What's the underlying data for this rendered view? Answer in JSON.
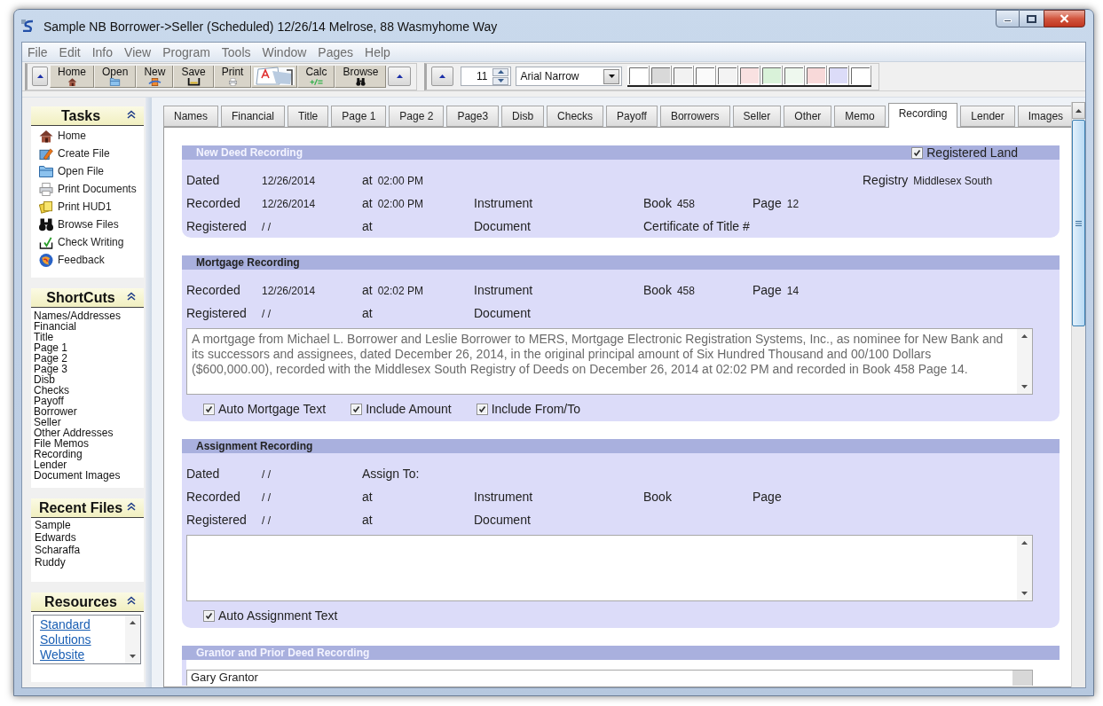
{
  "window": {
    "title": "Sample NB Borrower->Seller (Scheduled) 12/26/14 Melrose, 88 Wasmyhome Way"
  },
  "menu": [
    "File",
    "Edit",
    "Info",
    "View",
    "Program",
    "Tools",
    "Window",
    "Pages",
    "Help"
  ],
  "toolbar": {
    "buttons": [
      {
        "kind": "labeled",
        "label": "Home"
      },
      {
        "kind": "labeled",
        "label": "Open"
      },
      {
        "kind": "labeled",
        "label": "New"
      },
      {
        "kind": "labeled",
        "label": "Save"
      },
      {
        "kind": "labeled",
        "label": "Print"
      },
      {
        "kind": "picture"
      },
      {
        "kind": "labeled",
        "label": "Calc"
      },
      {
        "kind": "labeled",
        "label": "Browse"
      }
    ]
  },
  "format_bar": {
    "font_size": "11",
    "font": "Arial Narrow",
    "swatches": [
      {
        "color": "#ffffff"
      },
      {
        "color": "#d9d9d9"
      },
      {
        "color": "#f2f2f2"
      },
      {
        "color": "#fafafa"
      },
      {
        "color": "#f3f3f3"
      },
      {
        "color": "#f9e1e1"
      },
      {
        "color": "#d9f2d9"
      },
      {
        "color": "#eef8ee"
      },
      {
        "color": "#f8d9d9"
      },
      {
        "color": "#dcdcf8"
      },
      {
        "color": "#ffffff"
      }
    ]
  },
  "sidebar": {
    "panels": [
      {
        "title": "Tasks",
        "kind": "tasks",
        "items": [
          "Home",
          "Create File",
          "Open File",
          "Print Documents",
          "Print HUD1",
          "Browse Files",
          "Check Writing",
          "Feedback"
        ]
      },
      {
        "title": "ShortCuts",
        "kind": "list",
        "items": [
          "Names/Addresses",
          "Financial",
          "Title",
          "Page 1",
          "Page 2",
          "Page 3",
          "Disb",
          "Checks",
          "Payoff",
          "Borrower",
          "Seller",
          "Other Addresses",
          "File Memos",
          "Recording",
          "Lender",
          "Document Images"
        ]
      },
      {
        "title": "Recent Files",
        "kind": "recent",
        "items": [
          "Sample",
          "Edwards",
          "Scharaffa",
          "Ruddy"
        ]
      },
      {
        "title": "Resources",
        "kind": "links",
        "items": [
          "Standard Solutions Website"
        ]
      }
    ]
  },
  "tabs": [
    {
      "label": "Names",
      "selected": false
    },
    {
      "label": "Financial",
      "selected": false
    },
    {
      "label": "Title",
      "selected": false
    },
    {
      "label": "Page 1",
      "selected": false
    },
    {
      "label": "Page 2",
      "selected": false
    },
    {
      "label": "Page3",
      "selected": false
    },
    {
      "label": "Disb",
      "selected": false
    },
    {
      "label": "Checks",
      "selected": false
    },
    {
      "label": "Payoff",
      "selected": false
    },
    {
      "label": "Borrowers",
      "selected": false
    },
    {
      "label": "Seller",
      "selected": false
    },
    {
      "label": "Other",
      "selected": false
    },
    {
      "label": "Memo",
      "selected": false
    },
    {
      "label": "Recording",
      "selected": true
    },
    {
      "label": "Lender",
      "selected": false
    },
    {
      "label": "Images",
      "selected": false
    }
  ],
  "sections": [
    {
      "title": "New Deed Recording",
      "title_inverted": true,
      "checkbox": {
        "label": "Registered Land",
        "checked": true
      },
      "blocks": [
        {
          "kind": "rows",
          "rows": [
            {
              "date": {
                "label": "Dated",
                "value": "12/26/2014"
              },
              "time": {
                "label": "at",
                "value": "02:00 PM"
              },
              "registry": {
                "label": "Registry",
                "value": "Middlesex South"
              }
            },
            {
              "date": {
                "label": "Recorded",
                "value": "12/26/2014"
              },
              "time": {
                "label": "at",
                "value": "02:00 PM"
              },
              "document": {
                "label": "Instrument"
              },
              "book": {
                "label": "Book",
                "value": "458"
              },
              "page": {
                "label": "Page",
                "value": "12"
              }
            },
            {
              "date": {
                "label": "Registered",
                "value": "/ /"
              },
              "time": {
                "label": "at"
              },
              "document": {
                "label": "Document"
              },
              "certificate": {
                "label": "Certificate of Title #"
              }
            }
          ]
        }
      ]
    },
    {
      "title": "Mortgage Recording",
      "title_inverted": false,
      "blocks": [
        {
          "kind": "rows",
          "rows": [
            {
              "date": {
                "label": "Recorded",
                "value": "12/26/2014"
              },
              "time": {
                "label": "at",
                "value": "02:02 PM"
              },
              "document": {
                "label": "Instrument"
              },
              "book": {
                "label": "Book",
                "value": "458"
              },
              "page": {
                "label": "Page",
                "value": "14"
              }
            },
            {
              "date": {
                "label": "Registered",
                "value": "/ /"
              },
              "time": {
                "label": "at"
              },
              "document": {
                "label": "Document"
              }
            }
          ]
        },
        {
          "kind": "text_area",
          "value": "A mortgage from Michael L. Borrower and Leslie Borrower to MERS, Mortgage Electronic Registration Systems, Inc., as nominee for New Bank and its successors and assignees, dated December 26, 2014, in the original principal amount of Six Hundred Thousand and 00/100 Dollars ($600,000.00), recorded with the Middlesex South Registry of Deeds on December 26, 2014 at 02:02 PM and recorded in Book 458 Page 14."
        },
        {
          "kind": "checkboxes",
          "items": [
            {
              "label": "Auto Mortgage Text",
              "checked": true
            },
            {
              "label": "Include Amount",
              "checked": true
            },
            {
              "label": "Include From/To",
              "checked": true
            }
          ]
        }
      ]
    },
    {
      "title": "Assignment Recording",
      "title_inverted": false,
      "blocks": [
        {
          "kind": "rows",
          "rows": [
            {
              "date": {
                "label": "Dated",
                "value": "/ /"
              },
              "assign_to": {
                "label": "Assign To:"
              }
            },
            {
              "date": {
                "label": "Recorded",
                "value": "/ /"
              },
              "time": {
                "label": "at"
              },
              "document": {
                "label": "Instrument"
              },
              "book": {
                "label": "Book"
              },
              "page": {
                "label": "Page"
              }
            },
            {
              "date": {
                "label": "Registered",
                "value": "/ /"
              },
              "time": {
                "label": "at"
              },
              "document": {
                "label": "Document"
              }
            }
          ]
        },
        {
          "kind": "text_area"
        },
        {
          "kind": "checkboxes",
          "items": [
            {
              "label": "Auto Assignment Text",
              "checked": true
            }
          ]
        }
      ]
    },
    {
      "title": "Grantor and Prior Deed Recording",
      "title_inverted": true,
      "blocks": [
        {
          "kind": "text_field",
          "value": "Gary Grantor"
        }
      ]
    }
  ]
}
